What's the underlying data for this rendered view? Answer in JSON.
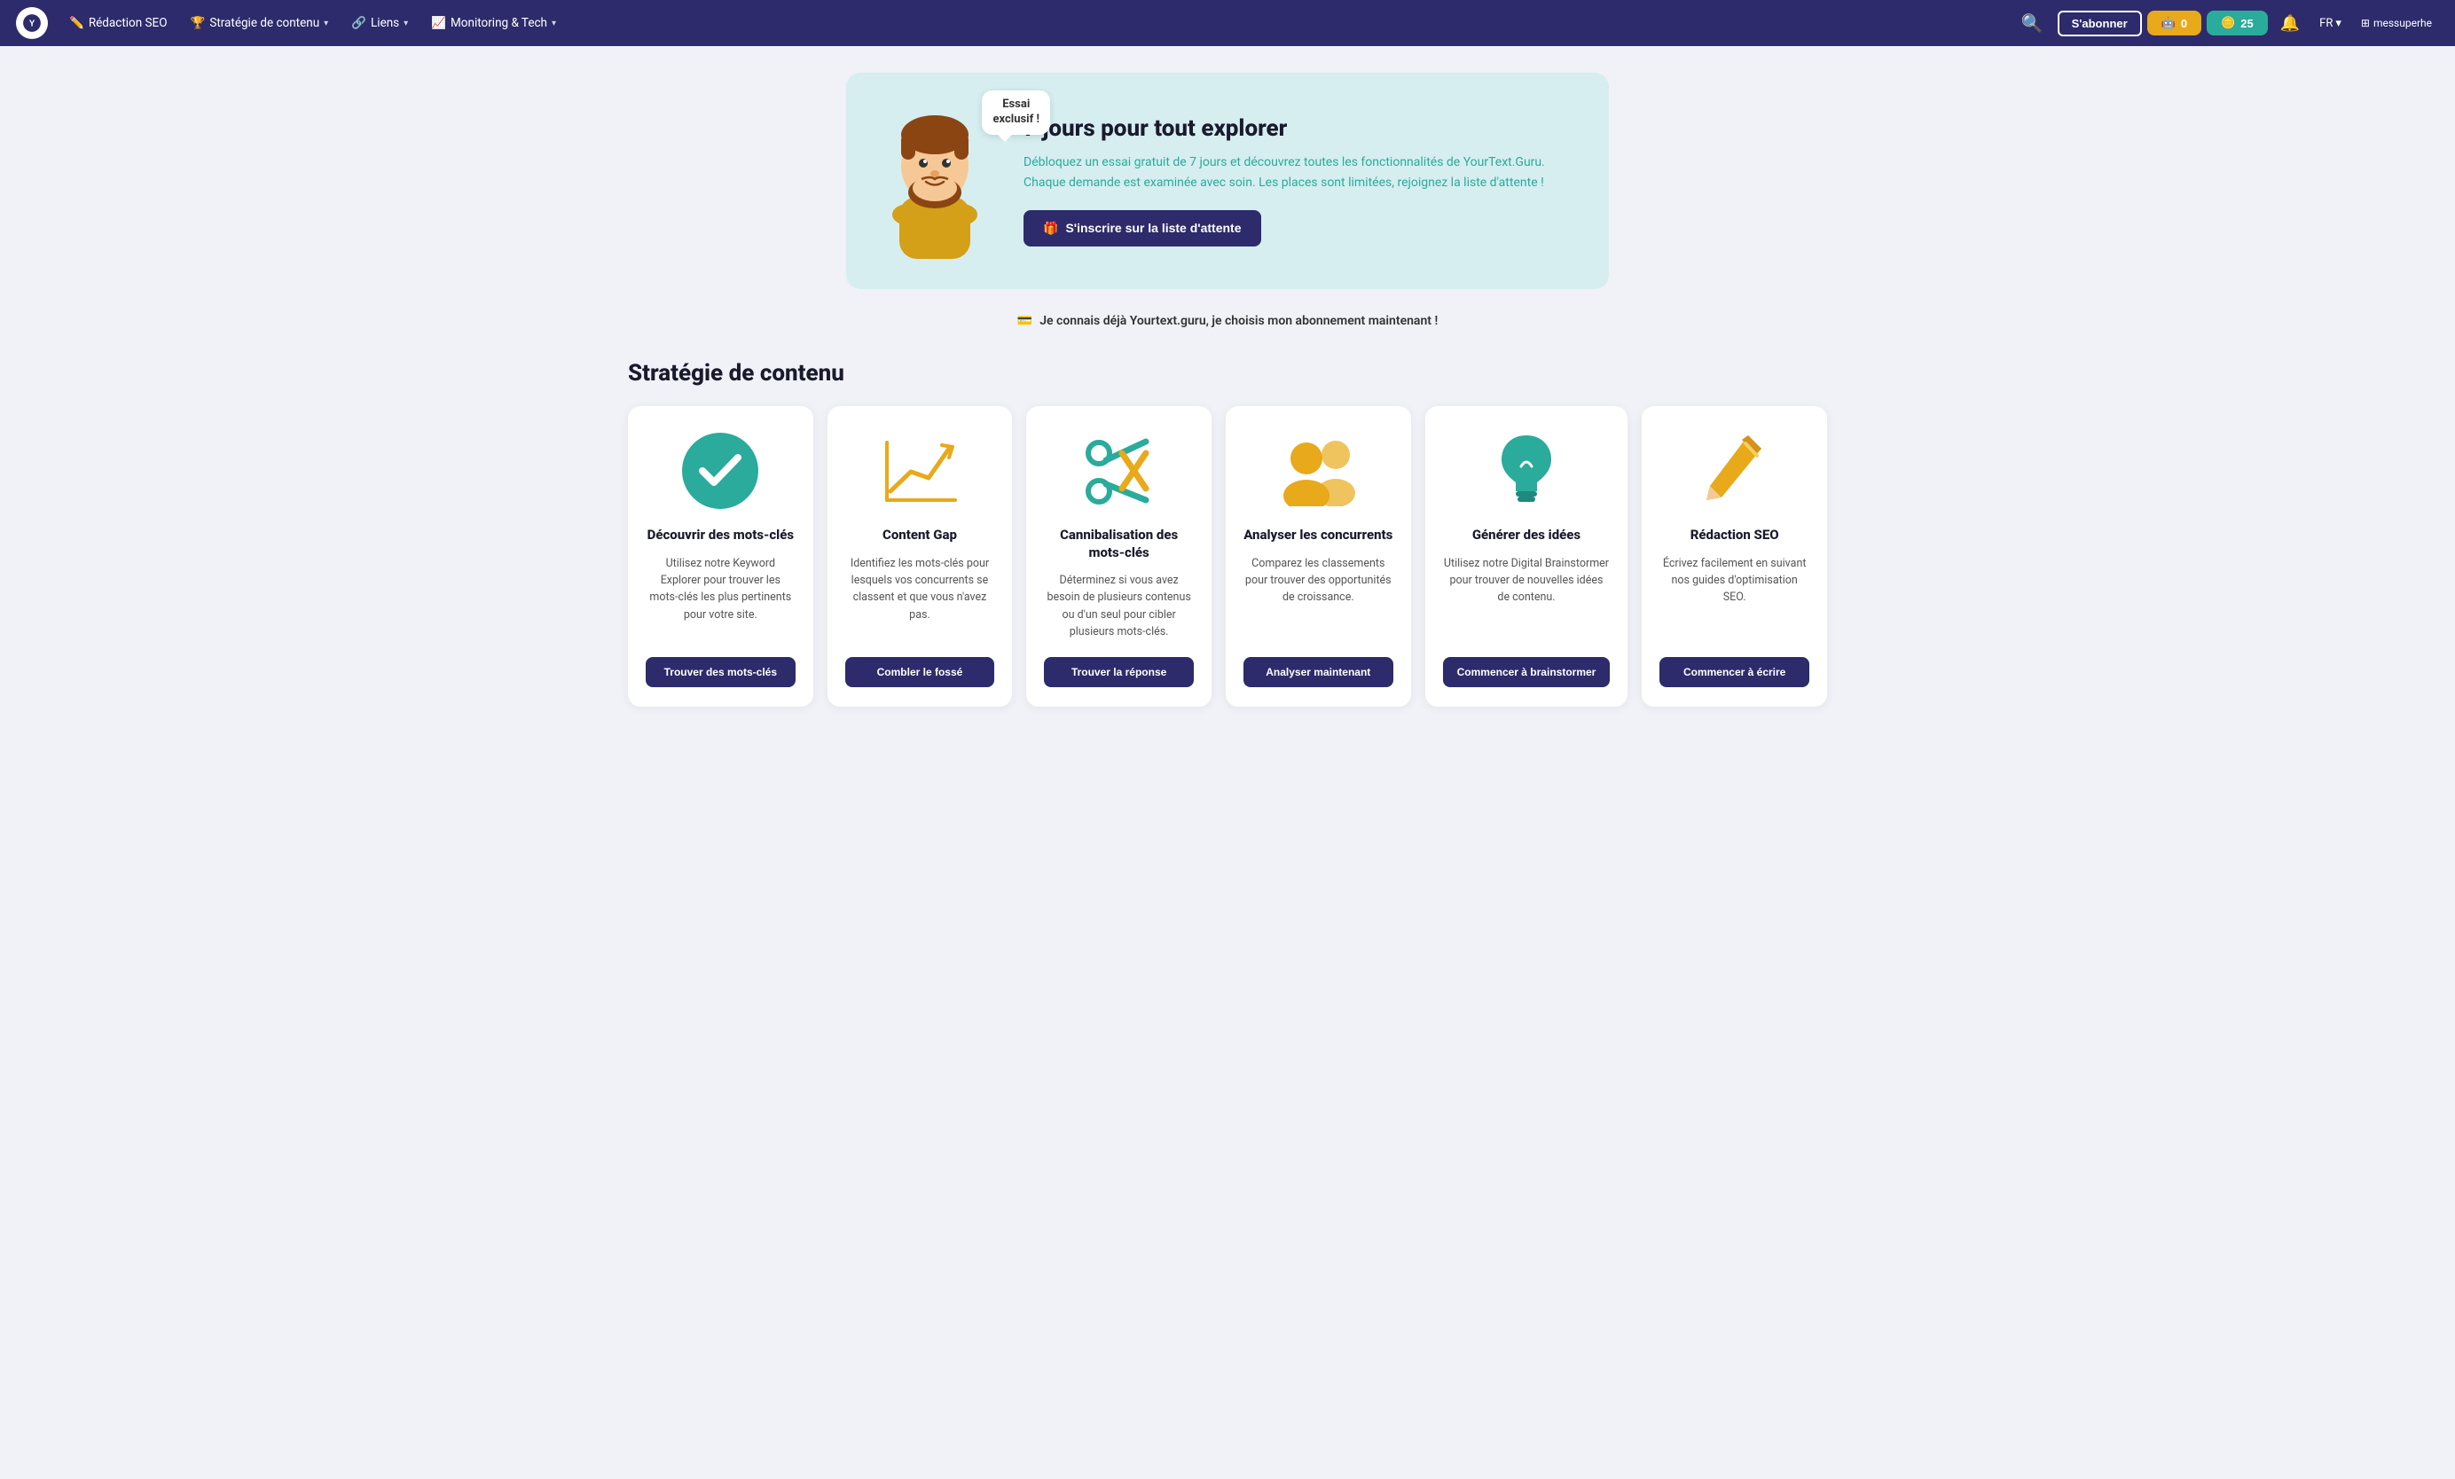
{
  "nav": {
    "logo_alt": "YourText.Guru logo",
    "links": [
      {
        "label": "Rédaction SEO",
        "has_dropdown": false,
        "icon": "pencil"
      },
      {
        "label": "Stratégie de contenu",
        "has_dropdown": true,
        "icon": "strategy"
      },
      {
        "label": "Liens",
        "has_dropdown": true,
        "icon": "links"
      },
      {
        "label": "Monitoring & Tech",
        "has_dropdown": true,
        "icon": "monitoring"
      }
    ],
    "subscribe_label": "S'abonner",
    "gold_btn_label": "0",
    "teal_btn_label": "25",
    "lang": "FR",
    "user": "messuperhe"
  },
  "promo": {
    "bubble_line1": "Essai",
    "bubble_line2": "exclusif !",
    "title": "7 jours pour tout explorer",
    "desc": "Débloquez un essai gratuit de 7 jours et découvrez\ntoutes les fonctionnalités de YourText.Guru.\nChaque demande est examinée avec soin. Les places\nsont limitées, rejoignez la liste d'attente !",
    "btn_label": "S'inscrire sur la liste d'attente",
    "btn_icon": "🎁"
  },
  "subscription_link": {
    "text": "Je connais déjà Yourtext.guru, je choisis mon abonnement maintenant !",
    "icon": "💳"
  },
  "content_strategy": {
    "section_title": "Stratégie de contenu",
    "cards": [
      {
        "id": "keywords",
        "title": "Découvrir des mots-clés",
        "desc": "Utilisez notre Keyword Explorer pour trouver les mots-clés les plus pertinents pour votre site.",
        "btn_label": "Trouver des mots-clés",
        "icon_type": "check-circle",
        "icon_color": "#2aab9b"
      },
      {
        "id": "content-gap",
        "title": "Content Gap",
        "desc": "Identifiez les mots-clés pour lesquels vos concurrents se classent et que vous n'avez pas.",
        "btn_label": "Combler le fossé",
        "icon_type": "chart-trend",
        "icon_color": "#e8a91a"
      },
      {
        "id": "cannibalisation",
        "title": "Cannibalisation des mots-clés",
        "desc": "Déterminez si vous avez besoin de plusieurs contenus ou d'un seul pour cibler plusieurs mots-clés.",
        "btn_label": "Trouver la réponse",
        "icon_type": "scissors",
        "icon_color": "#2aab9b"
      },
      {
        "id": "concurrents",
        "title": "Analyser les concurrents",
        "desc": "Comparez les classements pour trouver des opportunités de croissance.",
        "btn_label": "Analyser maintenant",
        "icon_type": "users",
        "icon_color": "#e8a91a"
      },
      {
        "id": "idees",
        "title": "Générer des idées",
        "desc": "Utilisez notre Digital Brainstormer pour trouver de nouvelles idées de contenu.",
        "btn_label": "Commencer à brainstormer",
        "icon_type": "lightbulb",
        "icon_color": "#2aab9b"
      },
      {
        "id": "redaction",
        "title": "Rédaction SEO",
        "desc": "Écrivez facilement en suivant nos guides d'optimisation SEO.",
        "btn_label": "Commencer à écrire",
        "icon_type": "pencil-gold",
        "icon_color": "#e8a91a"
      }
    ]
  }
}
